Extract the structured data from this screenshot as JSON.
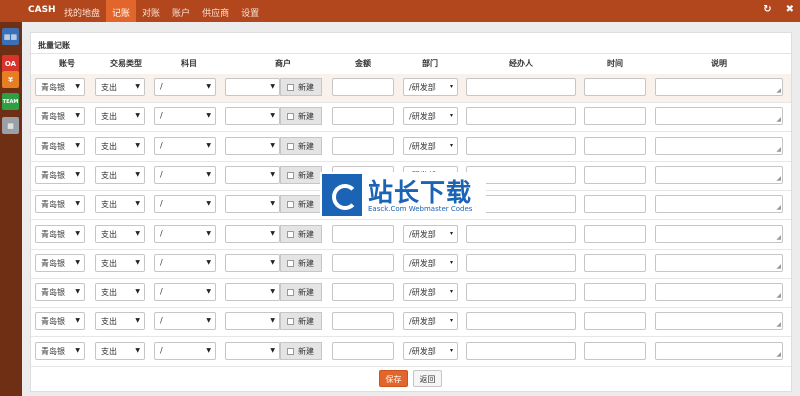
{
  "brand": "CASH",
  "nav": [
    "找的地盘",
    "记账",
    "对账",
    "账户",
    "供应商",
    "设置"
  ],
  "nav_active_index": 1,
  "top_icons": [
    {
      "glyph": "↻",
      "name": "refresh-icon"
    },
    {
      "glyph": "✖",
      "name": "close-icon"
    }
  ],
  "sidebar": [
    {
      "label": "▦▦",
      "name": "cash-app-icon",
      "color": "#3b6fb6"
    },
    {
      "label": "OA",
      "name": "oa-app-icon",
      "color": "#d9342b"
    },
    {
      "label": "¥",
      "name": "finance-app-icon",
      "color": "#e67e22"
    },
    {
      "label": "TEAM",
      "name": "team-app-icon",
      "color": "#2f9e44"
    },
    {
      "label": "▦",
      "name": "grid-app-icon",
      "color": "#9aa0a6"
    }
  ],
  "panel": {
    "title": "批量记账",
    "columns": [
      "账号",
      "交易类型",
      "科目",
      "商户",
      "金额",
      "部门",
      "经办人",
      "时间",
      "说明"
    ],
    "row_count": 10,
    "row_defaults": {
      "account": "青岛银",
      "type": "支出",
      "subject": "/",
      "merchant": "",
      "new_label": "新建",
      "amount": "",
      "department": "/研发部",
      "handler": "",
      "time": "",
      "note": ""
    },
    "save_label": "保存",
    "back_label": "返回"
  },
  "watermark": {
    "title": "站长下载",
    "subtitle": "Easck.Com Webmaster Codes"
  },
  "colors": {
    "topbar": "#b2461c",
    "nav_active": "#e2662b",
    "sidebar": "#6e2f14",
    "save_button": "#e2662b"
  }
}
